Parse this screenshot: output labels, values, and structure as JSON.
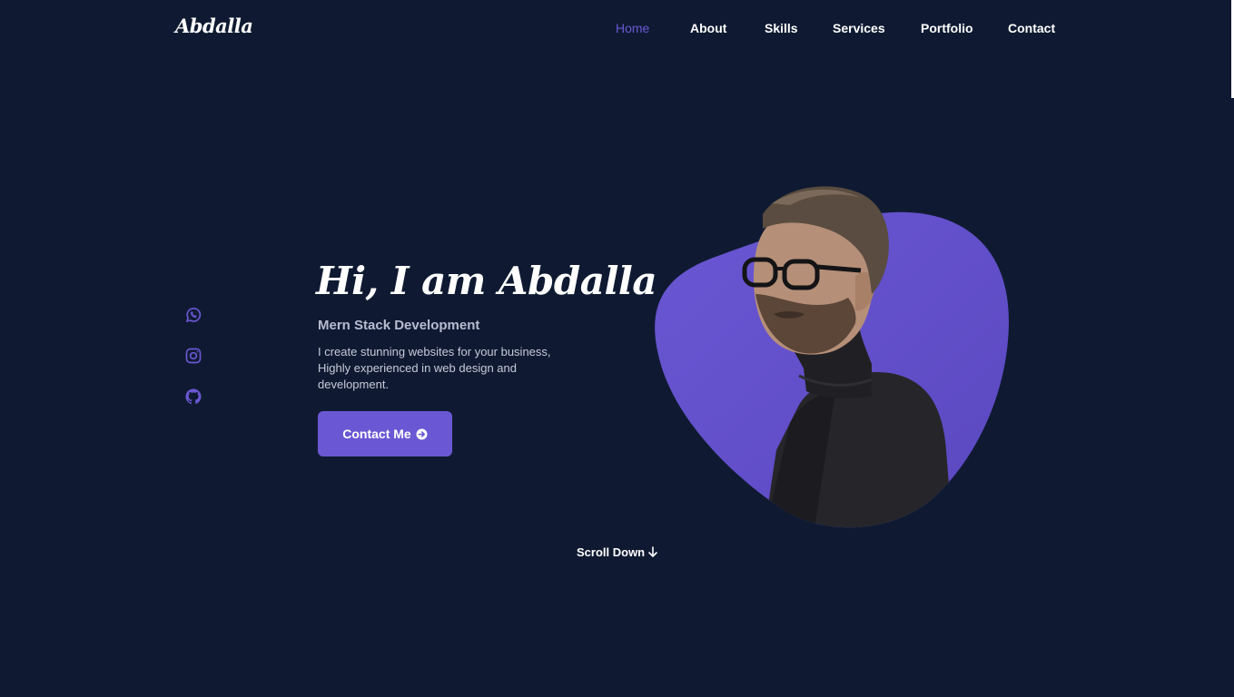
{
  "colors": {
    "background": "#0f1a32",
    "accent": "#6a57d3",
    "text": "#ffffff",
    "muted_text": "#c7cad8"
  },
  "header": {
    "logo": "Abdalla",
    "nav": [
      {
        "label": "Home",
        "active": true
      },
      {
        "label": "About",
        "active": false
      },
      {
        "label": "Skills",
        "active": false
      },
      {
        "label": "Services",
        "active": false
      },
      {
        "label": "Portfolio",
        "active": false
      },
      {
        "label": "Contact",
        "active": false
      }
    ]
  },
  "social": [
    {
      "icon": "whatsapp-icon"
    },
    {
      "icon": "instagram-icon"
    },
    {
      "icon": "github-icon"
    }
  ],
  "hero": {
    "title": "Hi, I am Abdalla",
    "subtitle": "Mern Stack Development",
    "description": "I create stunning websites for your business, Highly experienced in web design and development.",
    "button_label": "Contact Me",
    "button_icon": "arrow-right-circle-icon"
  },
  "scroll": {
    "label": "Scroll Down",
    "icon": "arrow-down-icon"
  }
}
